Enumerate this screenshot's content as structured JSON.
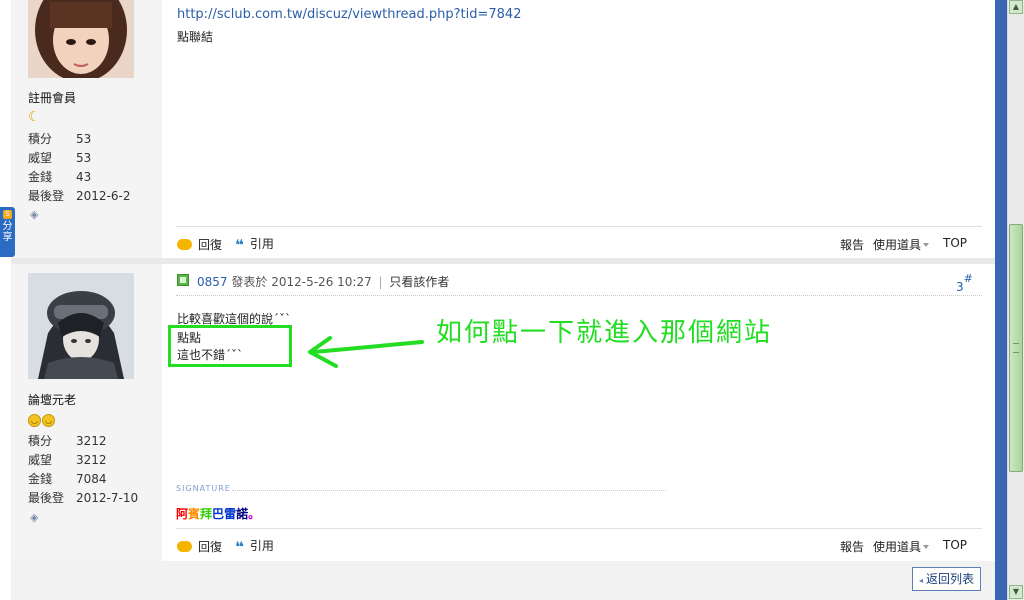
{
  "share_tab": {
    "icon": "share-icon",
    "label": "分享"
  },
  "post1": {
    "user": {
      "rank": "註冊會員",
      "rank_icon": "moon-icon",
      "stats": [
        {
          "label": "積分",
          "value": "53"
        },
        {
          "label": "威望",
          "value": "53"
        },
        {
          "label": "金錢",
          "value": "43"
        },
        {
          "label": "最後登",
          "value": "2012-6-2"
        }
      ]
    },
    "link_url": "http://sclub.com.tw/discuz/viewthread.php?tid=7842",
    "link_caption": "點聯結",
    "actions": {
      "reply": "回復",
      "quote": "引用",
      "report": "報告",
      "tools": "使用道具",
      "top": "TOP"
    }
  },
  "post2": {
    "user": {
      "name": "論壇元老",
      "stats": [
        {
          "label": "積分",
          "value": "3212"
        },
        {
          "label": "威望",
          "value": "3212"
        },
        {
          "label": "金錢",
          "value": "7084"
        },
        {
          "label": "最後登",
          "value": "2012-7-10"
        }
      ]
    },
    "header": {
      "author": "0857",
      "posted_label": "發表於",
      "datetime": "2012-5-26 10:27",
      "separator": "|",
      "only_author": "只看該作者",
      "floor": "3",
      "floor_mark": "#"
    },
    "lines": [
      "比較喜歡這個的說ˊˇˋ",
      "點點",
      "這也不錯ˊˇˋ"
    ],
    "signature_label": "SIGNATURE",
    "signature": [
      {
        "text": "阿",
        "color": "#ff0000"
      },
      {
        "text": "賓",
        "color": "#ff8c00"
      },
      {
        "text": "拜",
        "color": "#33cc00"
      },
      {
        "text": "巴",
        "color": "#0033cc"
      },
      {
        "text": "雷",
        "color": "#0033cc"
      },
      {
        "text": "諾",
        "color": "#000080"
      },
      {
        "text": "。",
        "color": "#cc00cc"
      }
    ],
    "actions": {
      "reply": "回復",
      "quote": "引用",
      "report": "報告",
      "tools": "使用道具",
      "top": "TOP"
    }
  },
  "annotation": {
    "text": "如何點一下就進入那個網站",
    "color": "#22dd22"
  },
  "footer": {
    "back_label": "返回列表"
  }
}
